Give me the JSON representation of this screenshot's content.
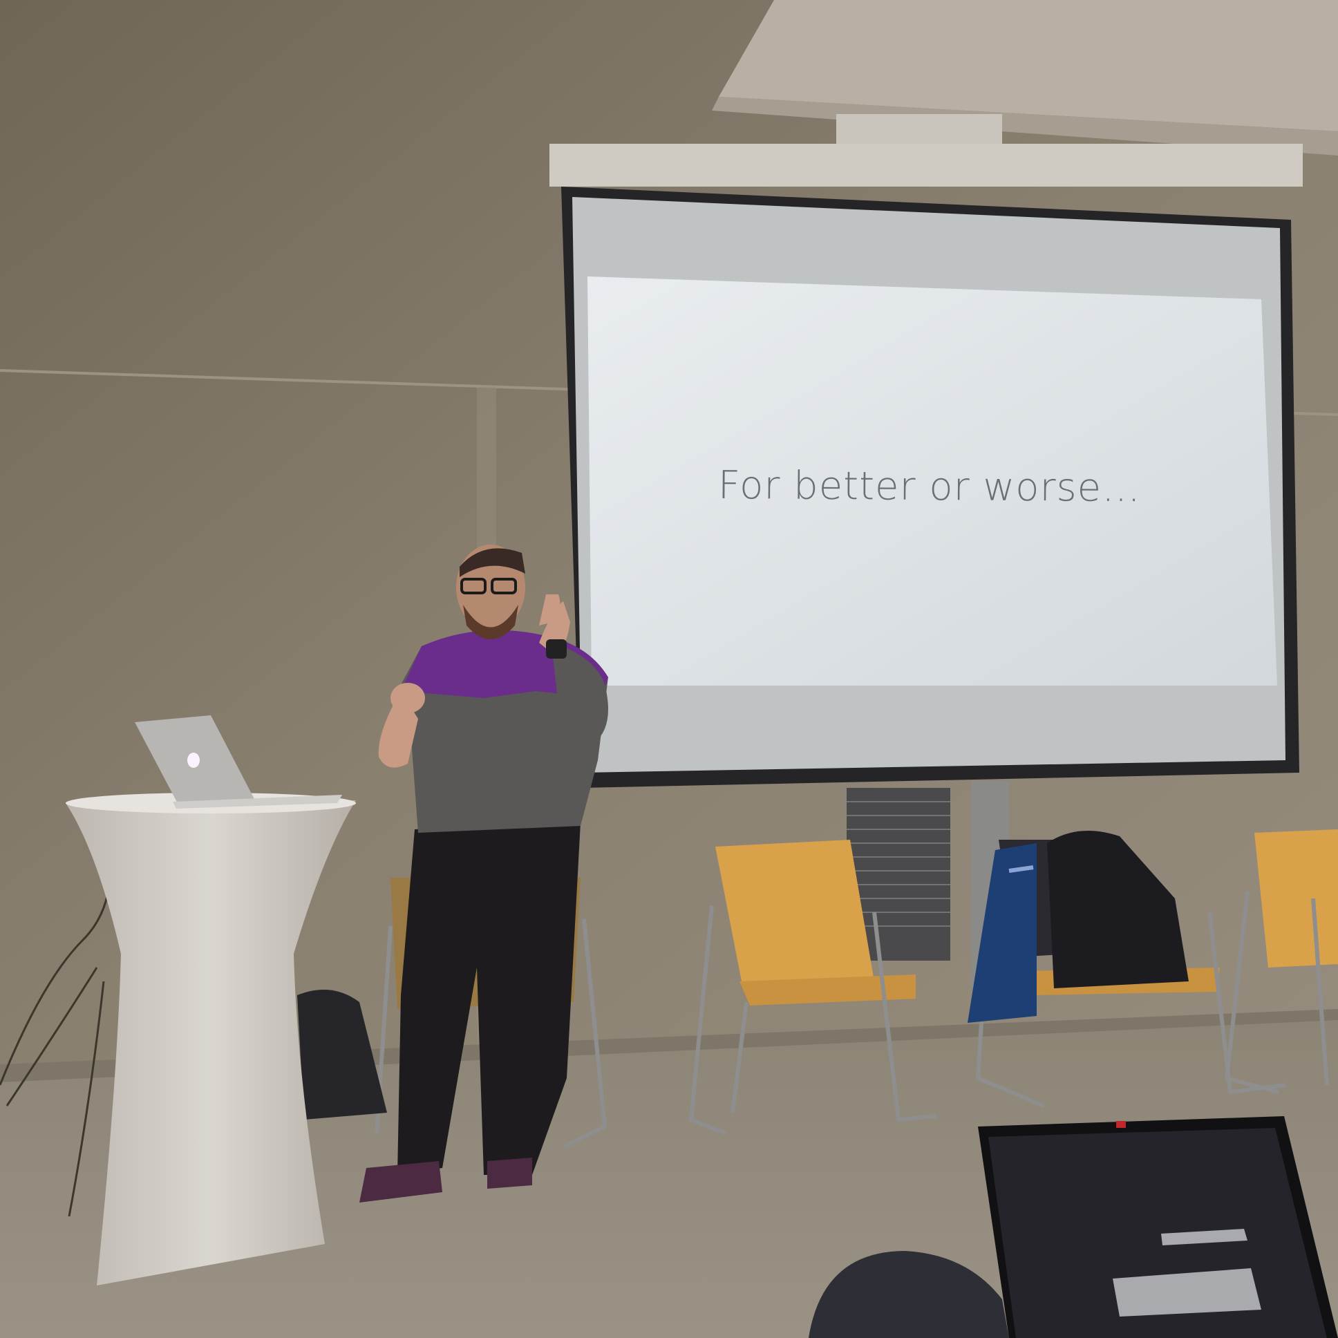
{
  "scene": {
    "slide_text": "For better or worse…"
  },
  "colors": {
    "wall": "#8a7f6f",
    "ceiling": "#b3ab9f",
    "floor": "#8d8576",
    "screen": "#dfe4e8",
    "shirt_purple": "#6b2d8c",
    "shirt_grey": "#5a5856",
    "chair_seat": "#d9a24a"
  }
}
